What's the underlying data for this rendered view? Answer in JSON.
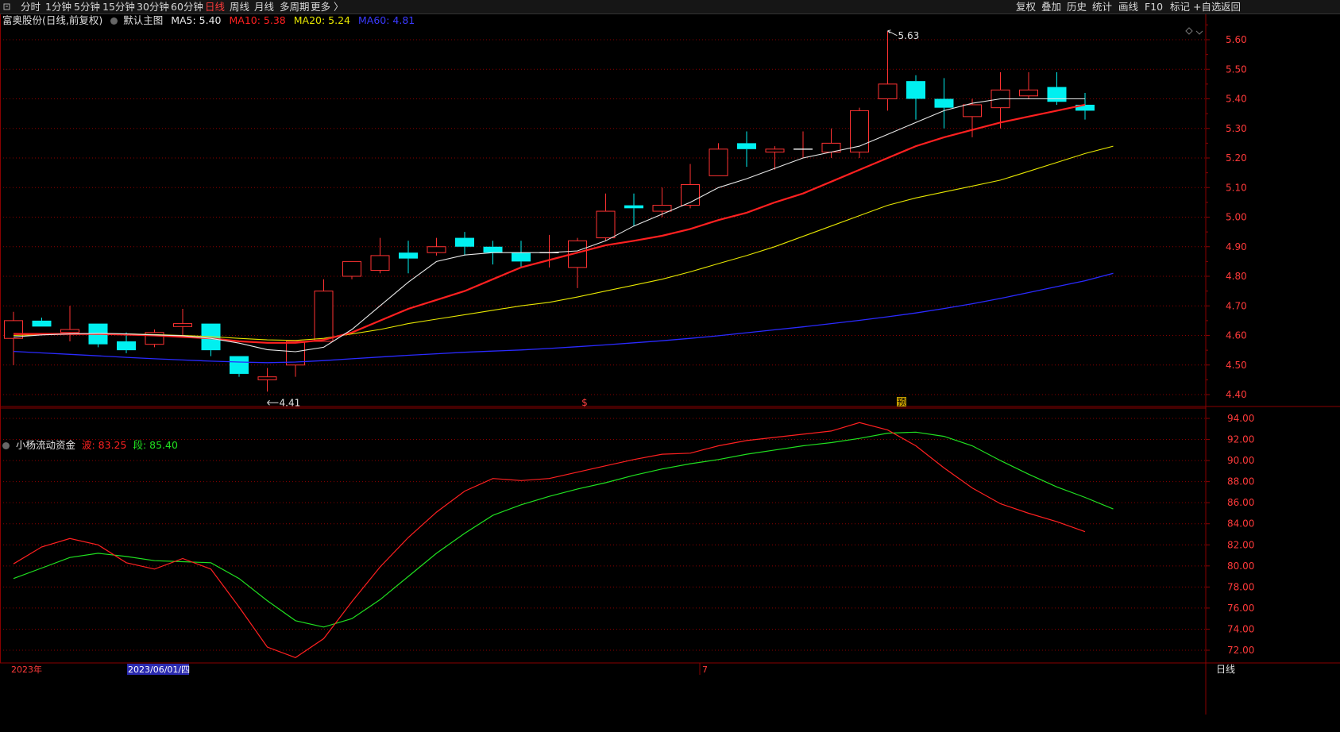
{
  "toolbar": {
    "left": [
      {
        "label": "分时"
      },
      {
        "label": "1分钟"
      },
      {
        "label": "5分钟"
      },
      {
        "label": "15分钟"
      },
      {
        "label": "30分钟"
      },
      {
        "label": "60分钟"
      },
      {
        "label": "日线",
        "active": true
      },
      {
        "label": "周线"
      },
      {
        "label": "月线"
      },
      {
        "label": "多周期"
      },
      {
        "label": "更多 〉"
      }
    ],
    "right": [
      {
        "label": "复权"
      },
      {
        "label": "叠加"
      },
      {
        "label": "历史"
      },
      {
        "label": "统计"
      },
      {
        "label": "画线"
      },
      {
        "label": "F10"
      },
      {
        "label": "标记"
      },
      {
        "label": "+自选"
      },
      {
        "label": "返回"
      }
    ]
  },
  "main_info": {
    "stock": "富奥股份(日线,前复权)",
    "template": "默认主图",
    "ma5": "MA5: 5.40",
    "ma10": "MA10: 5.38",
    "ma20": "MA20: 5.24",
    "ma60": "MA60: 4.81"
  },
  "sub_info": {
    "name": "小杨流动资金",
    "bo": "波: 83.25",
    "duan": "段: 85.40"
  },
  "colors": {
    "up": "#ff3232",
    "down": "#00f0f0",
    "ma5": "#e8e8e8",
    "ma10": "#ff2020",
    "ma20": "#e6e600",
    "ma60": "#2a2aff",
    "bo": "#ff2020",
    "duan": "#20e020",
    "grid": "#8a0000"
  },
  "annotations": {
    "high": "5.63",
    "low": "4.41",
    "marker_s": "$",
    "marker_yu": "预"
  },
  "x_axis": {
    "label_year": "2023年",
    "label_date": "2023/06/01/四",
    "label_month": "7",
    "period": "日线"
  },
  "chart_data": [
    {
      "type": "candlestick",
      "title": "富奥股份(日线,前复权)",
      "ylim": [
        4.38,
        5.66
      ],
      "y_ticks": [
        "5.60",
        "5.50",
        "5.40",
        "5.30",
        "5.20",
        "5.10",
        "5.00",
        "4.90",
        "4.80",
        "4.70",
        "4.60",
        "4.50",
        "4.40"
      ],
      "candles": [
        {
          "o": 4.59,
          "h": 4.68,
          "l": 4.5,
          "c": 4.65
        },
        {
          "o": 4.65,
          "h": 4.66,
          "l": 4.63,
          "c": 4.63
        },
        {
          "o": 4.61,
          "h": 4.7,
          "l": 4.58,
          "c": 4.62
        },
        {
          "o": 4.64,
          "h": 4.64,
          "l": 4.56,
          "c": 4.57
        },
        {
          "o": 4.58,
          "h": 4.61,
          "l": 4.54,
          "c": 4.55
        },
        {
          "o": 4.57,
          "h": 4.62,
          "l": 4.56,
          "c": 4.61
        },
        {
          "o": 4.63,
          "h": 4.69,
          "l": 4.6,
          "c": 4.64
        },
        {
          "o": 4.64,
          "h": 4.64,
          "l": 4.53,
          "c": 4.55
        },
        {
          "o": 4.53,
          "h": 4.53,
          "l": 4.46,
          "c": 4.47
        },
        {
          "o": 4.45,
          "h": 4.49,
          "l": 4.41,
          "c": 4.46
        },
        {
          "o": 4.5,
          "h": 4.58,
          "l": 4.46,
          "c": 4.58
        },
        {
          "o": 4.58,
          "h": 4.79,
          "l": 4.58,
          "c": 4.75
        },
        {
          "o": 4.8,
          "h": 4.85,
          "l": 4.79,
          "c": 4.85
        },
        {
          "o": 4.82,
          "h": 4.93,
          "l": 4.81,
          "c": 4.87
        },
        {
          "o": 4.88,
          "h": 4.92,
          "l": 4.81,
          "c": 4.86
        },
        {
          "o": 4.88,
          "h": 4.93,
          "l": 4.87,
          "c": 4.9
        },
        {
          "o": 4.93,
          "h": 4.95,
          "l": 4.87,
          "c": 4.9
        },
        {
          "o": 4.9,
          "h": 4.92,
          "l": 4.84,
          "c": 4.88
        },
        {
          "o": 4.88,
          "h": 4.92,
          "l": 4.83,
          "c": 4.85
        },
        {
          "o": 4.88,
          "h": 4.94,
          "l": 4.83,
          "c": 4.88
        },
        {
          "o": 4.83,
          "h": 4.93,
          "l": 4.76,
          "c": 4.92
        },
        {
          "o": 4.93,
          "h": 5.08,
          "l": 4.92,
          "c": 5.02
        },
        {
          "o": 5.04,
          "h": 5.08,
          "l": 4.97,
          "c": 5.03
        },
        {
          "o": 5.02,
          "h": 5.1,
          "l": 5.0,
          "c": 5.04
        },
        {
          "o": 5.04,
          "h": 5.18,
          "l": 5.03,
          "c": 5.11
        },
        {
          "o": 5.14,
          "h": 5.25,
          "l": 5.14,
          "c": 5.23
        },
        {
          "o": 5.25,
          "h": 5.29,
          "l": 5.17,
          "c": 5.23
        },
        {
          "o": 5.22,
          "h": 5.24,
          "l": 5.16,
          "c": 5.23
        },
        {
          "o": 5.23,
          "h": 5.29,
          "l": 5.2,
          "c": 5.23
        },
        {
          "o": 5.22,
          "h": 5.3,
          "l": 5.2,
          "c": 5.25
        },
        {
          "o": 5.22,
          "h": 5.37,
          "l": 5.2,
          "c": 5.36
        },
        {
          "o": 5.4,
          "h": 5.63,
          "l": 5.36,
          "c": 5.45
        },
        {
          "o": 5.46,
          "h": 5.48,
          "l": 5.33,
          "c": 5.4
        },
        {
          "o": 5.4,
          "h": 5.47,
          "l": 5.3,
          "c": 5.37
        },
        {
          "o": 5.34,
          "h": 5.4,
          "l": 5.27,
          "c": 5.38
        },
        {
          "o": 5.37,
          "h": 5.49,
          "l": 5.3,
          "c": 5.43
        },
        {
          "o": 5.41,
          "h": 5.49,
          "l": 5.4,
          "c": 5.43
        },
        {
          "o": 5.44,
          "h": 5.49,
          "l": 5.38,
          "c": 5.39
        },
        {
          "o": 5.38,
          "h": 5.42,
          "l": 5.33,
          "c": 5.36
        }
      ],
      "ma5": [
        4.595,
        4.602,
        4.605,
        4.607,
        4.605,
        4.602,
        4.599,
        4.59,
        4.574,
        4.552,
        4.545,
        4.56,
        4.62,
        4.7,
        4.78,
        4.85,
        4.872,
        4.88,
        4.88,
        4.88,
        4.886,
        4.92,
        4.97,
        5.01,
        5.05,
        5.1,
        5.13,
        5.165,
        5.2,
        5.22,
        5.24,
        5.28,
        5.32,
        5.36,
        5.385,
        5.4,
        5.4,
        5.4,
        5.4
      ],
      "ma10": [
        4.605,
        4.605,
        4.605,
        4.605,
        4.603,
        4.6,
        4.595,
        4.59,
        4.58,
        4.575,
        4.575,
        4.585,
        4.61,
        4.65,
        4.69,
        4.72,
        4.75,
        4.79,
        4.83,
        4.855,
        4.88,
        4.905,
        4.92,
        4.937,
        4.96,
        4.99,
        5.015,
        5.05,
        5.08,
        5.12,
        5.16,
        5.2,
        5.24,
        5.27,
        5.295,
        5.32,
        5.34,
        5.36,
        5.38
      ],
      "ma20": [
        4.6,
        4.603,
        4.605,
        4.606,
        4.605,
        4.603,
        4.6,
        4.596,
        4.59,
        4.585,
        4.583,
        4.59,
        4.605,
        4.62,
        4.64,
        4.655,
        4.67,
        4.685,
        4.7,
        4.712,
        4.73,
        4.75,
        4.77,
        4.79,
        4.815,
        4.843,
        4.87,
        4.9,
        4.935,
        4.97,
        5.005,
        5.04,
        5.065,
        5.085,
        5.105,
        5.125,
        5.155,
        5.185,
        5.215,
        5.24
      ],
      "ma60": [
        4.546,
        4.541,
        4.536,
        4.531,
        4.526,
        4.521,
        4.517,
        4.513,
        4.51,
        4.508,
        4.51,
        4.515,
        4.521,
        4.527,
        4.533,
        4.538,
        4.543,
        4.547,
        4.551,
        4.556,
        4.562,
        4.568,
        4.575,
        4.582,
        4.59,
        4.599,
        4.609,
        4.619,
        4.629,
        4.64,
        4.651,
        4.663,
        4.676,
        4.691,
        4.707,
        4.725,
        4.745,
        4.765,
        4.785,
        4.81
      ]
    },
    {
      "type": "line",
      "title": "小杨流动资金",
      "ylim": [
        71.0,
        95.0
      ],
      "y_ticks": [
        "94.00",
        "92.00",
        "90.00",
        "88.00",
        "86.00",
        "84.00",
        "82.00",
        "80.00",
        "78.00",
        "76.00",
        "74.00",
        "72.00"
      ],
      "series": [
        {
          "name": "波",
          "values": [
            80.2,
            81.8,
            82.6,
            82.0,
            80.3,
            79.7,
            80.7,
            79.7,
            76.1,
            72.3,
            71.3,
            73.1,
            76.6,
            79.9,
            82.7,
            85.1,
            87.1,
            88.3,
            88.1,
            88.3,
            88.9,
            89.5,
            90.1,
            90.6,
            90.7,
            91.4,
            91.9,
            92.2,
            92.5,
            92.8,
            93.6,
            92.9,
            91.4,
            89.3,
            87.4,
            85.9,
            85.0,
            84.2,
            83.25
          ]
        },
        {
          "name": "段",
          "values": [
            78.8,
            79.8,
            80.8,
            81.2,
            80.9,
            80.5,
            80.4,
            80.3,
            78.8,
            76.7,
            74.8,
            74.2,
            75.0,
            76.8,
            79.0,
            81.2,
            83.1,
            84.8,
            85.8,
            86.6,
            87.3,
            87.9,
            88.6,
            89.2,
            89.7,
            90.1,
            90.6,
            91.0,
            91.4,
            91.7,
            92.1,
            92.6,
            92.7,
            92.3,
            91.4,
            90.0,
            88.7,
            87.5,
            86.5,
            85.4
          ]
        }
      ]
    }
  ]
}
